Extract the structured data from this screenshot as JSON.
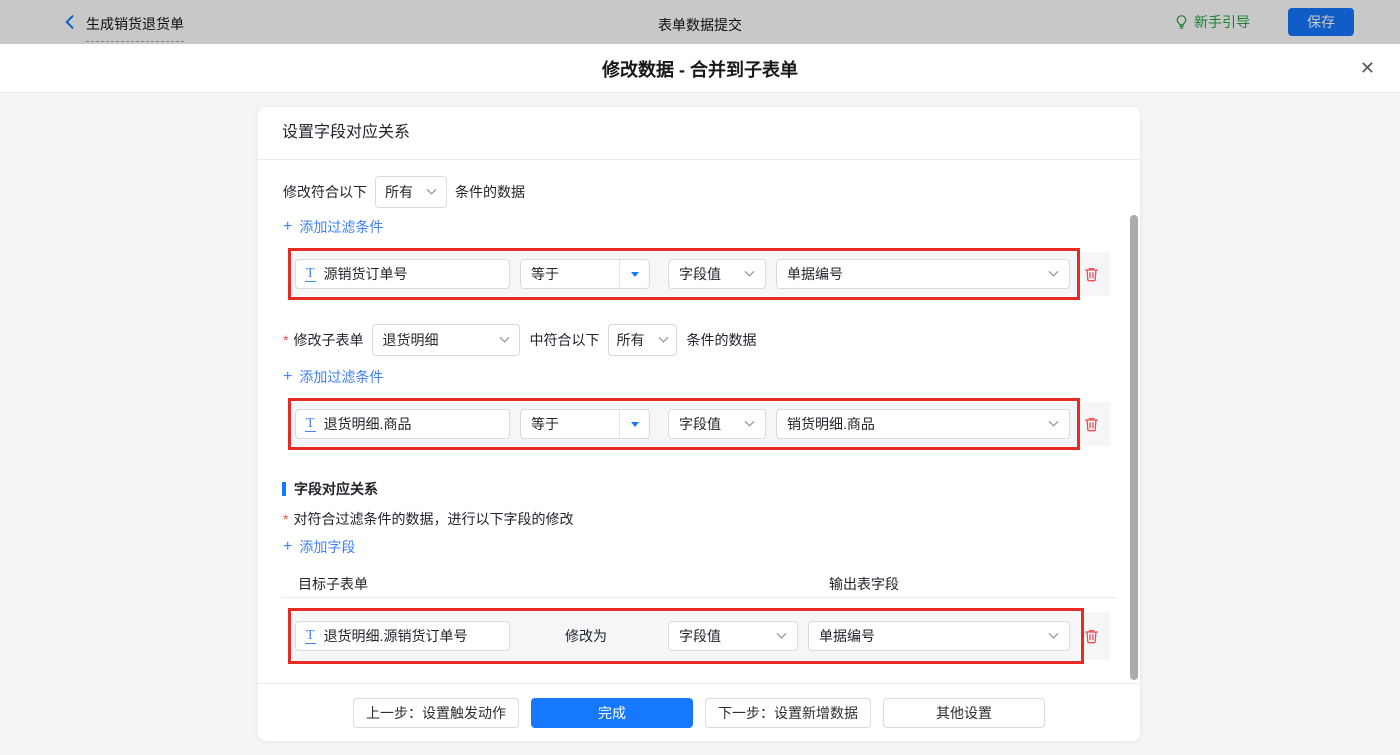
{
  "topbar": {
    "back_title": "生成销货退货单",
    "center_title": "表单数据提交",
    "guide_label": "新手引导",
    "save_label": "保存"
  },
  "modal": {
    "title": "修改数据 - 合并到子表单",
    "close_glyph": "✕"
  },
  "icons": {
    "plus": "+",
    "required_mark": "*"
  },
  "card": {
    "header": "设置字段对应关系",
    "filter1": {
      "prefix": "修改符合以下",
      "match_mode": "所有",
      "suffix": "条件的数据",
      "add_label": "添加过滤条件",
      "row": {
        "field": "源销货订单号",
        "operator": "等于",
        "value_type": "字段值",
        "value": "单据编号"
      }
    },
    "filter2": {
      "label": "修改子表单",
      "subform": "退货明细",
      "mid": "中符合以下",
      "match_mode": "所有",
      "suffix": "条件的数据",
      "add_label": "添加过滤条件",
      "row": {
        "field": "退货明细.商品",
        "operator": "等于",
        "value_type": "字段值",
        "value": "销货明细.商品"
      }
    },
    "mapping": {
      "section_title": "字段对应关系",
      "desc": "对符合过滤条件的数据，进行以下字段的修改",
      "add_label": "添加字段",
      "col1": "目标子表单",
      "col2": "输出表字段",
      "row": {
        "field": "退货明细.源销货订单号",
        "middle": "修改为",
        "value_type": "字段值",
        "value": "单据编号"
      }
    },
    "footer": {
      "prev": "上一步：设置触发动作",
      "done": "完成",
      "next": "下一步：设置新增数据",
      "other": "其他设置"
    }
  },
  "colors": {
    "accent_blue": "#1677ff",
    "link_blue": "#4080ff",
    "guide_green": "#2aa342",
    "annotation_red": "#e52b24",
    "trash_red": "#f04b50",
    "content_bg": "#f4f5f6",
    "row_bg": "#f5f6f7"
  }
}
